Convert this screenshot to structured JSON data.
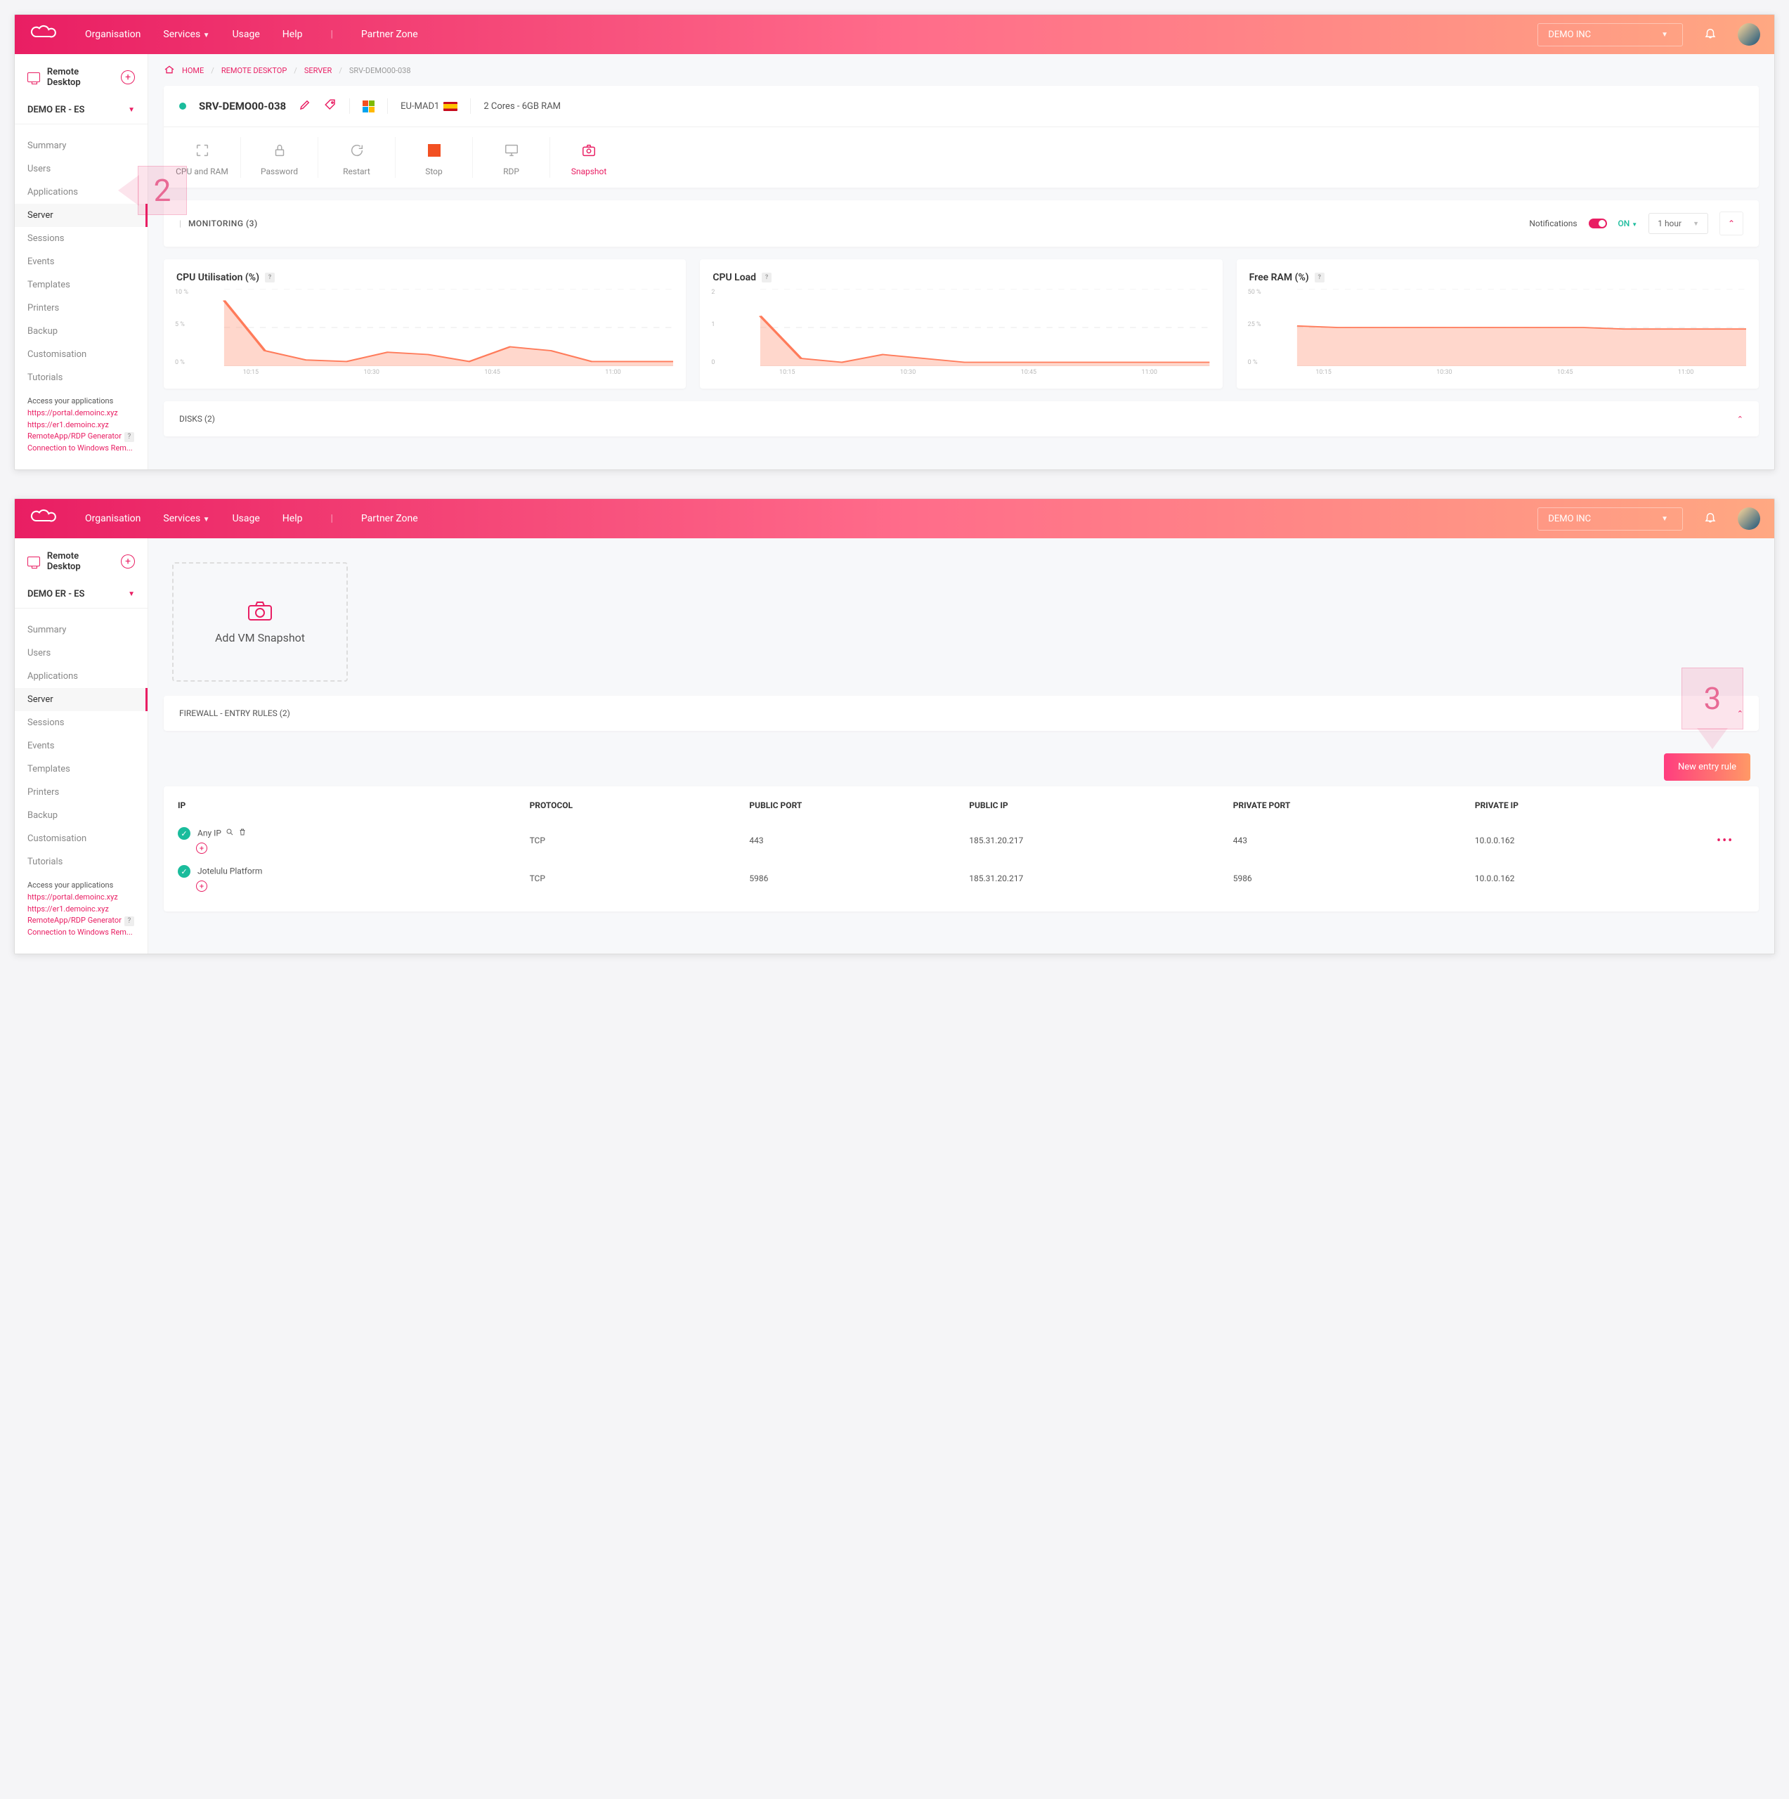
{
  "topbar": {
    "nav": {
      "org": "Organisation",
      "services": "Services",
      "usage": "Usage",
      "help": "Help",
      "partner": "Partner Zone"
    },
    "org_dropdown": "DEMO INC"
  },
  "sidebar": {
    "title": "Remote Desktop",
    "account": "DEMO ER - ES",
    "items": [
      "Summary",
      "Users",
      "Applications",
      "Server",
      "Sessions",
      "Events",
      "Templates",
      "Printers",
      "Backup",
      "Customisation",
      "Tutorials"
    ],
    "access_header": "Access your applications",
    "links": [
      "https://portal.demoinc.xyz",
      "https://er1.demoinc.xyz",
      "RemoteApp/RDP Generator",
      "Connection to Windows Rem..."
    ]
  },
  "crumbs": {
    "home": "HOME",
    "rd": "REMOTE DESKTOP",
    "server": "SERVER",
    "srv": "SRV-DEMO00-038"
  },
  "server_header": {
    "name": "SRV-DEMO00-038",
    "region": "EU-MAD1",
    "spec": "2 Cores - 6GB RAM"
  },
  "actions": {
    "cpu": "CPU and RAM",
    "pwd": "Password",
    "restart": "Restart",
    "stop": "Stop",
    "rdp": "RDP",
    "snapshot": "Snapshot"
  },
  "monitoring": {
    "label": "MONITORING (3)",
    "notif_label": "Notifications",
    "on": "ON",
    "range": "1 hour"
  },
  "charts": {
    "cpu_util": "CPU Utilisation (%)",
    "cpu_load": "CPU Load",
    "free_ram": "Free RAM (%)",
    "x_ticks": [
      "10:15",
      "10:30",
      "10:45",
      "11:00"
    ],
    "cpu_util_y": [
      "10 %",
      "5 %",
      "0 %"
    ],
    "cpu_load_y": [
      "2",
      "1",
      "0"
    ],
    "free_ram_y": [
      "50 %",
      "25 %",
      "0 %"
    ]
  },
  "disks": {
    "label": "DISKS (2)"
  },
  "snapshot_box": {
    "label": "Add VM Snapshot"
  },
  "firewall": {
    "label": "FIREWALL - ENTRY RULES (2)",
    "new_rule": "New entry rule",
    "cols": {
      "ip": "IP",
      "proto": "PROTOCOL",
      "pubport": "PUBLIC PORT",
      "pubip": "PUBLIC IP",
      "privport": "PRIVATE PORT",
      "privip": "PRIVATE IP"
    },
    "rows": [
      {
        "ip": "Any IP",
        "proto": "TCP",
        "pubport": "443",
        "pubip": "185.31.20.217",
        "privport": "443",
        "privip": "10.0.0.162",
        "has_icons": true,
        "has_dots": true
      },
      {
        "ip": "Jotelulu Platform",
        "proto": "TCP",
        "pubport": "5986",
        "pubip": "185.31.20.217",
        "privport": "5986",
        "privip": "10.0.0.162",
        "has_icons": false,
        "has_dots": false
      }
    ]
  },
  "callouts": {
    "two": "2",
    "three": "3"
  },
  "chart_data": [
    {
      "type": "area",
      "title": "CPU Utilisation (%)",
      "ylim": [
        0,
        10
      ],
      "x": [
        "10:10",
        "10:15",
        "10:20",
        "10:25",
        "10:30",
        "10:35",
        "10:40",
        "10:45",
        "10:50",
        "10:55",
        "11:00",
        "11:05"
      ],
      "values": [
        8.5,
        2,
        0.8,
        0.6,
        1.8,
        1.5,
        0.6,
        2.5,
        2.0,
        0.6,
        0.6,
        0.6
      ]
    },
    {
      "type": "area",
      "title": "CPU Load",
      "ylim": [
        0,
        2
      ],
      "x": [
        "10:10",
        "10:15",
        "10:20",
        "10:25",
        "10:30",
        "10:35",
        "10:40",
        "10:45",
        "10:50",
        "10:55",
        "11:00",
        "11:05"
      ],
      "values": [
        1.3,
        0.2,
        0.1,
        0.3,
        0.2,
        0.1,
        0.1,
        0.1,
        0.1,
        0.1,
        0.1,
        0.1
      ]
    },
    {
      "type": "area",
      "title": "Free RAM (%)",
      "ylim": [
        0,
        50
      ],
      "x": [
        "10:10",
        "10:15",
        "10:20",
        "10:25",
        "10:30",
        "10:35",
        "10:40",
        "10:45",
        "10:50",
        "10:55",
        "11:00",
        "11:05"
      ],
      "values": [
        26,
        25,
        25,
        25,
        25,
        25,
        25,
        25,
        24,
        24,
        24,
        24
      ]
    }
  ]
}
